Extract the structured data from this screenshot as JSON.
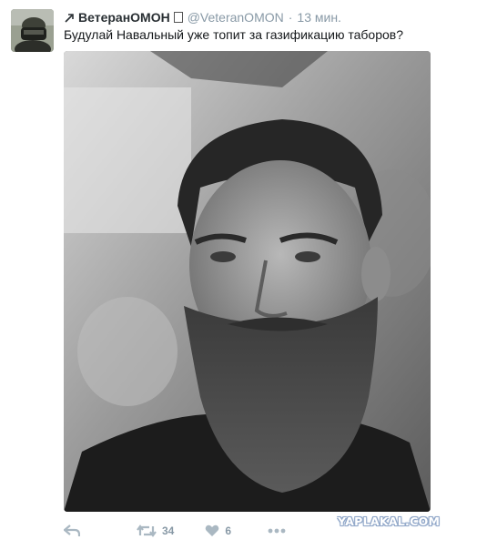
{
  "tweet": {
    "display_name": "ВетеранОМОН",
    "verified_glyph": "⃞",
    "handle": "@VeteranOMON",
    "separator": "·",
    "time": "13 мин.",
    "text": "Будулай Навальный уже топит за газификацию таборов?",
    "avatar_icon": "avatar-photo",
    "follow_icon": "follow-arrow-icon",
    "photo_description_icon": "bearded-man-photo"
  },
  "actions": {
    "reply_icon": "reply-icon",
    "retweet_icon": "retweet-icon",
    "retweet_count": "34",
    "like_icon": "heart-icon",
    "like_count": "6",
    "more_icon": "more-dots-icon"
  },
  "watermark": {
    "text": "YAPLAKAL.COM"
  },
  "colors": {
    "name": "#292f33",
    "muted": "#8899a6",
    "text": "#14171a",
    "watermark_outline": "#8fa6c8"
  }
}
